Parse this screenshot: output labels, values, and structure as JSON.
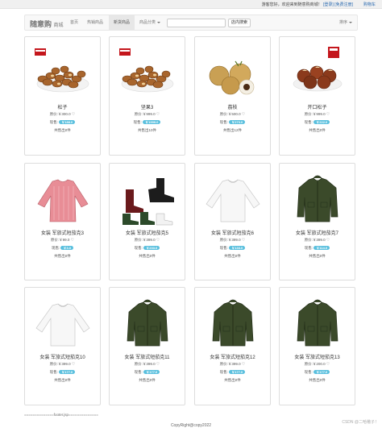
{
  "topbar": {
    "welcome": "游客您好，欢迎来到随意购商城！",
    "login": "[登录]",
    "register": "[免费注册]",
    "cart": "购物车"
  },
  "navbar": {
    "brand": "随意购",
    "brand_suffix": "商城",
    "items": [
      "首页",
      "热销商品",
      "新货商品",
      "商品分类"
    ],
    "active_index": 2,
    "search": {
      "placeholder": "",
      "value": "",
      "button": "店内搜索"
    },
    "sort_label": "排序"
  },
  "labels": {
    "original_price": "原价:",
    "current_price": "现售:",
    "sold_prefix": "共售出",
    "sold_suffix": "件",
    "currency": "￥"
  },
  "products": [
    {
      "name": "松子",
      "original": "300.0",
      "current": "￥188.0",
      "sold": "0",
      "image": "nuts-icon",
      "favorite": "favorite-icon"
    },
    {
      "name": "坚果3",
      "original": "999.0",
      "current": "￥1999.0",
      "sold": "10",
      "image": "nuts-icon",
      "favorite": "favorite-icon"
    },
    {
      "name": "荔枝",
      "original": "500.0",
      "current": "￥273.0",
      "sold": "12",
      "image": "longan-icon",
      "favorite": "favorite-icon"
    },
    {
      "name": "开口松子",
      "original": "999.0",
      "current": "￥222.0",
      "sold": "0",
      "image": "chestnut-icon",
      "favorite": "favorite-icon"
    },
    {
      "name": "女装 军旅式短茄克3",
      "original": "99.0",
      "current": "￥3.0",
      "sold": "0",
      "image": "pink-blouse-icon",
      "favorite": "favorite-icon"
    },
    {
      "name": "女装 军旅式短茄克5",
      "original": "399.0",
      "current": "￥233.0",
      "sold": "0",
      "image": "boots-icon",
      "favorite": "favorite-icon"
    },
    {
      "name": "女装 军旅式短茄克6",
      "original": "399.0",
      "current": "￥133.0",
      "sold": "0",
      "image": "white-shirt-icon",
      "favorite": "favorite-icon"
    },
    {
      "name": "女装 军旅式短茄克7",
      "original": "399.0",
      "current": "￥114.0",
      "sold": "0",
      "image": "green-jacket-icon",
      "favorite": "favorite-icon"
    },
    {
      "name": "女装 军旅式短茄克10",
      "original": "399.0",
      "current": "￥177.0",
      "sold": "0",
      "image": "white-shirt-icon",
      "favorite": "favorite-icon"
    },
    {
      "name": "女装 军旅式短茄克11",
      "original": "399.0",
      "current": "￥177.0",
      "sold": "0",
      "image": "green-jacket-icon",
      "favorite": "favorite-icon"
    },
    {
      "name": "女装 军旅式短茄克12",
      "original": "399.0",
      "current": "￥177.0",
      "sold": "0",
      "image": "green-jacket-icon",
      "favorite": "favorite-icon"
    },
    {
      "name": "女装 军旅式短茄克13",
      "original": "200.0",
      "current": "￥177.0",
      "sold": "0",
      "image": "green-jacket-icon",
      "favorite": "favorite-icon"
    }
  ],
  "footer": {
    "include_marker": "==============footer.jsp==============",
    "copyright": "CopyRight@copy2022",
    "watermark": "CSDN @二哈嗷子！"
  },
  "colors": {
    "price_badge": "#5bc0de",
    "nav_active": "#e7e7e7",
    "link": "#2a6ab0"
  }
}
